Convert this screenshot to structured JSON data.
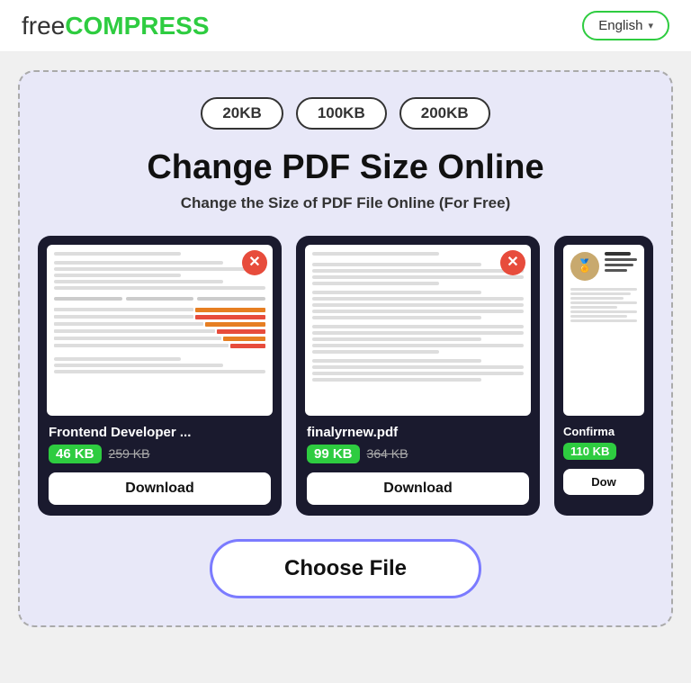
{
  "header": {
    "logo_free": "free",
    "logo_compress": "COMPRESS",
    "lang_label": "English",
    "lang_chevron": "▾"
  },
  "hero": {
    "badge_20": "20KB",
    "badge_100": "100KB",
    "badge_200": "200KB",
    "main_title": "Change PDF Size Online",
    "sub_title": "Change the Size of PDF File Online (For Free)"
  },
  "cards": [
    {
      "filename": "Frontend Developer ...",
      "size_new": "46 KB",
      "size_old": "259 KB",
      "download_label": "Download",
      "close_icon": "✕"
    },
    {
      "filename": "finalyrnew.pdf",
      "size_new": "99 KB",
      "size_old": "364 KB",
      "download_label": "Download",
      "close_icon": "✕"
    },
    {
      "filename": "Confirma",
      "size_new": "110 KB",
      "size_old": "",
      "download_label": "Dow",
      "close_icon": ""
    }
  ],
  "choose_file": {
    "label": "Choose File"
  }
}
